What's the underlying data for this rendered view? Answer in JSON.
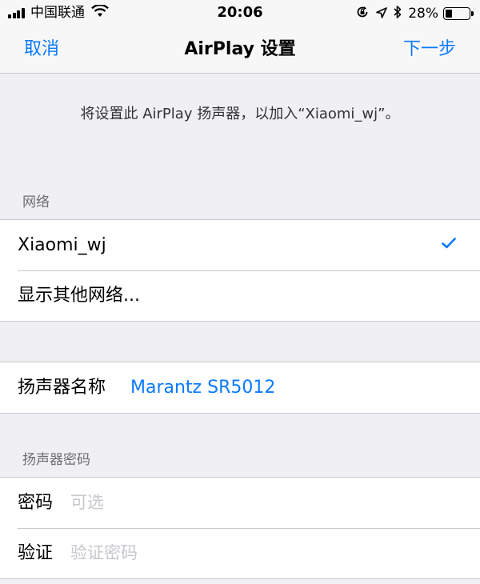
{
  "status_bar": {
    "carrier": "中国联通",
    "time": "20:06",
    "battery": "28%",
    "battery_level": 0.28,
    "icons": [
      "signal-icon",
      "wifi-icon",
      "orientation-lock-icon",
      "location-icon",
      "bluetooth-icon",
      "battery-icon"
    ]
  },
  "nav": {
    "cancel": "取消",
    "title": "AirPlay 设置",
    "next": "下一步"
  },
  "info_text": "将设置此 AirPlay 扬声器，以加入“Xiaomi_wj”。",
  "network": {
    "header": "网络",
    "items": [
      {
        "label": "Xiaomi_wj",
        "selected": true
      },
      {
        "label": "显示其他网络..."
      }
    ]
  },
  "speaker_name": {
    "label": "扬声器名称",
    "value": "Marantz SR5012"
  },
  "password": {
    "header": "扬声器密码",
    "password_label": "密码",
    "password_placeholder": "可选",
    "verify_label": "验证",
    "verify_placeholder": "验证密码"
  },
  "colors": {
    "accent": "#0a7aff",
    "background": "#efeff4",
    "separator": "#c8c7cc"
  }
}
